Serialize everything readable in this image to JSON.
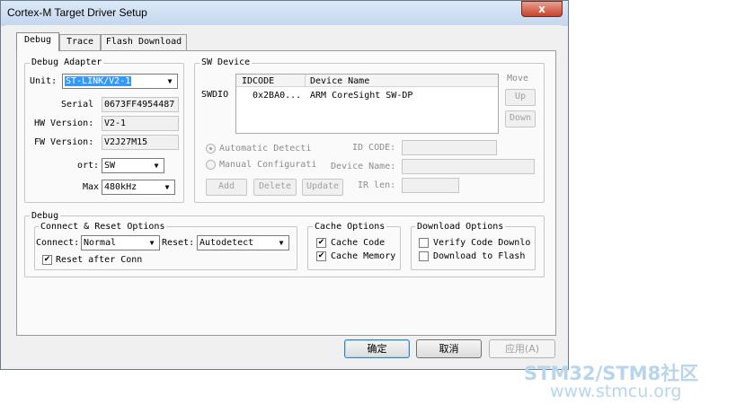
{
  "window": {
    "title": "Cortex-M Target Driver Setup",
    "close_glyph": "x"
  },
  "tabs": [
    {
      "label": "Debug",
      "active": true
    },
    {
      "label": "Trace",
      "active": false
    },
    {
      "label": "Flash Download",
      "active": false
    }
  ],
  "debug_adapter": {
    "legend": "Debug Adapter",
    "unit_label": "Unit:",
    "unit_value": "ST-LINK/V2-1",
    "serial_label": "Serial",
    "serial_value": "0673FF4954487",
    "hw_label": "HW Version:",
    "hw_value": "V2-1",
    "fw_label": "FW Version:",
    "fw_value": "V2J27M15",
    "port_label": "ort:",
    "port_value": "SW",
    "max_label": "Max",
    "max_value": "480kHz"
  },
  "sw_device": {
    "legend": "SW Device",
    "swdio_label": "SWDIO",
    "columns": [
      "IDCODE",
      "Device Name"
    ],
    "rows": [
      {
        "idcode": "0x2BA0...",
        "device_name": "ARM CoreSight SW-DP"
      }
    ],
    "move_label": "Move",
    "up_label": "Up",
    "down_label": "Down",
    "auto_detect_label": "Automatic Detecti",
    "manual_config_label": "Manual Configurati",
    "id_code_label": "ID CODE:",
    "device_name_label": "Device Name:",
    "ir_len_label": "IR len:",
    "add_label": "Add",
    "delete_label": "Delete",
    "update_label": "Update"
  },
  "debug": {
    "legend": "Debug",
    "connect_reset": {
      "legend": "Connect & Reset Options",
      "connect_label": "Connect:",
      "connect_value": "Normal",
      "reset_label": "Reset:",
      "reset_value": "Autodetect",
      "reset_after_conn_label": "Reset after Conn",
      "reset_after_conn_checked": true
    },
    "cache": {
      "legend": "Cache Options",
      "cache_code_label": "Cache Code",
      "cache_code_checked": true,
      "cache_memory_label": "Cache Memory",
      "cache_memory_checked": true
    },
    "download": {
      "legend": "Download Options",
      "verify_label": "Verify Code Downlo",
      "verify_checked": false,
      "download_flash_label": "Download to Flash",
      "download_flash_checked": false
    }
  },
  "buttons": {
    "ok": "确定",
    "cancel": "取消",
    "apply": "应用(A)"
  },
  "check_glyph": "✔",
  "arrow_glyph": "▼",
  "watermark": {
    "line1": "STM32/STM8社区",
    "line2": "www.stmcu.org"
  }
}
